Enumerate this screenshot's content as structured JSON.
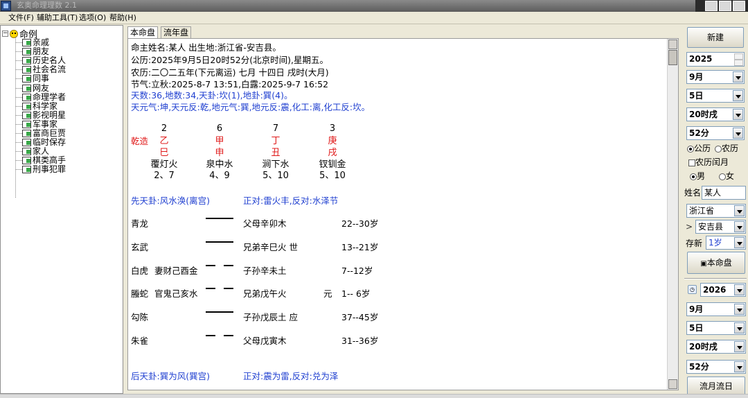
{
  "window": {
    "title": "玄奥命理理数 2.1"
  },
  "menu": [
    "文件(F)",
    "辅助工具(T)",
    "选项(O)",
    "帮助(H)"
  ],
  "tree": {
    "root": "命例",
    "items": [
      "亲戚",
      "朋友",
      "历史名人",
      "社会名流",
      "同事",
      "网友",
      "命理学者",
      "科学家",
      "影视明星",
      "军事家",
      "富商巨贾",
      "临时保存",
      "家人",
      "棋类高手",
      "刑事犯罪"
    ]
  },
  "tabs": [
    "本命盘",
    "流年盘"
  ],
  "chart": {
    "lines": [
      "命主姓名:某人   出生地:浙江省-安吉县。",
      "公历:2025年9月5日20时52分(北京时间),星期五。",
      "农历:二〇二五年(下元离运) 七月 十四日 戌时(大月)",
      "节气:立秋:2025-8-7 13:51,白露:2025-9-7 16:52"
    ],
    "blue_lines": [
      "天数:36,地数:34,天卦:坎(1),地卦:巽(4)。",
      "天元气:坤,天元反:乾,地元气:巽,地元反:震,化工:离,化工反:坎。"
    ],
    "qianzao": "乾造",
    "pillars": [
      {
        "num": "2",
        "stem": "乙",
        "branch": "巳",
        "nayin": "覆灯火",
        "nums": "2、7"
      },
      {
        "num": "6",
        "stem": "甲",
        "branch": "申",
        "nayin": "泉中水",
        "nums": "4、9"
      },
      {
        "num": "7",
        "stem": "丁",
        "branch": "丑",
        "nayin": "涧下水",
        "nums": "5、10"
      },
      {
        "num": "3",
        "stem": "庚",
        "branch": "戌",
        "nayin": "钗钏金",
        "nums": "5、10"
      }
    ],
    "xiantian": {
      "name": "先天卦:风水涣(离宫)",
      "relation": "正对:雷火丰,反对:水泽节"
    },
    "yao_rows": [
      {
        "god": "青龙",
        "fu": "",
        "yao": "yang",
        "liuqin": "父母辛卯木",
        "mark": "",
        "age": "22--30岁"
      },
      {
        "god": "玄武",
        "fu": "",
        "yao": "yang",
        "liuqin": "兄弟辛巳火 世",
        "mark": "",
        "age": "13--21岁"
      },
      {
        "god": "白虎",
        "fu": "妻财己酉金",
        "yao": "yin",
        "liuqin": "子孙辛未土",
        "mark": "",
        "age": "7--12岁"
      },
      {
        "god": "螣蛇",
        "fu": "官鬼己亥水",
        "yao": "yin",
        "liuqin": "兄弟戊午火",
        "mark": "元",
        "age": "1-- 6岁"
      },
      {
        "god": "勾陈",
        "fu": "",
        "yao": "yang",
        "liuqin": "子孙戊辰土 应",
        "mark": "",
        "age": "37--45岁"
      },
      {
        "god": "朱雀",
        "fu": "",
        "yao": "yin",
        "liuqin": "父母戊寅木",
        "mark": "",
        "age": "31--36岁"
      }
    ],
    "houtian": {
      "name": "后天卦:巽为风(巽宫)",
      "relation": "正对:震为雷,反对:兑为泽"
    }
  },
  "form": {
    "new_button": "新建",
    "year": "2025",
    "month": "9月",
    "day": "5日",
    "hour": "20时戌",
    "minute": "52分",
    "calendar_solar": "公历",
    "calendar_lunar": "农历",
    "leap_month": "农历闰月",
    "male": "男",
    "female": "女",
    "name_label": "姓名",
    "name_value": "某人",
    "province": "浙江省",
    "county_prefix": ">",
    "county": "安吉县",
    "save_label": "存新",
    "save_value": "1岁",
    "chart_button": "本命盘"
  },
  "flow": {
    "year": "2026",
    "month": "9月",
    "day": "5日",
    "hour": "20时戌",
    "minute": "52分",
    "button": "流月流日"
  }
}
